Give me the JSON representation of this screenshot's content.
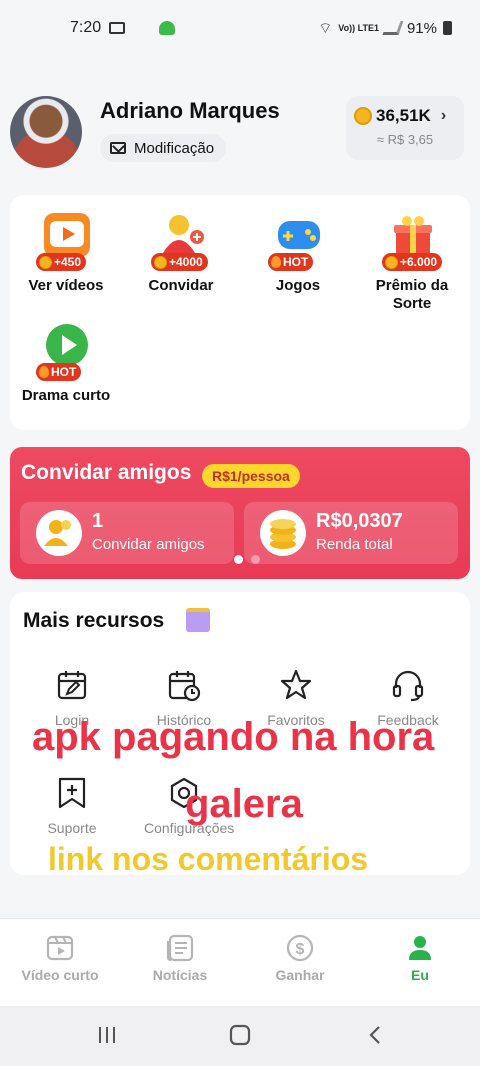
{
  "status_bar": {
    "time": "7:20",
    "network": "Vo)) LTE1",
    "battery": "91%"
  },
  "profile": {
    "name": "Adriano Marques",
    "modify_label": "Modificação",
    "coins": "36,51K",
    "cash": "≈ R$ 3,65"
  },
  "features": [
    {
      "label": "Ver vídeos",
      "badge": "+450",
      "icon": "tv-play-icon"
    },
    {
      "label": "Convidar",
      "badge": "+4000",
      "icon": "invite-person-icon"
    },
    {
      "label": "Jogos",
      "badge": "HOT",
      "icon": "gamepad-icon"
    },
    {
      "label": "Prêmio da Sorte",
      "badge": "+6.000",
      "icon": "gift-box-icon"
    },
    {
      "label": "Drama curto",
      "badge": "HOT",
      "icon": "play-circle-icon"
    }
  ],
  "invite": {
    "title": "Convidar amigos",
    "rate": "R$1/pessoa",
    "friends_count": "1",
    "friends_label": "Convidar amigos",
    "income_value": "R$0,0307",
    "income_label": "Renda total"
  },
  "resources": {
    "title": "Mais recursos",
    "items": [
      {
        "label": "Login",
        "icon": "calendar-edit-icon"
      },
      {
        "label": "Histórico",
        "icon": "calendar-clock-icon"
      },
      {
        "label": "Favoritos",
        "icon": "star-icon"
      },
      {
        "label": "Feedback",
        "icon": "headset-icon"
      },
      {
        "label": "Suporte",
        "icon": "bookmark-plus-icon"
      },
      {
        "label": "Configurações",
        "icon": "settings-hex-icon"
      }
    ]
  },
  "overlay": {
    "line1": "apk pagando na hora",
    "line2": "galera",
    "line3": "link nos comentários"
  },
  "bottom_nav": [
    {
      "label": "Vídeo curto",
      "icon": "clapper-icon"
    },
    {
      "label": "Notícias",
      "icon": "news-icon"
    },
    {
      "label": "Ganhar",
      "icon": "dollar-coin-icon"
    },
    {
      "label": "Eu",
      "icon": "person-icon",
      "active": true
    }
  ],
  "colors": {
    "accent": "#2ab24a",
    "invite_bg": "#e83a55",
    "pill": "#ffd62c"
  }
}
